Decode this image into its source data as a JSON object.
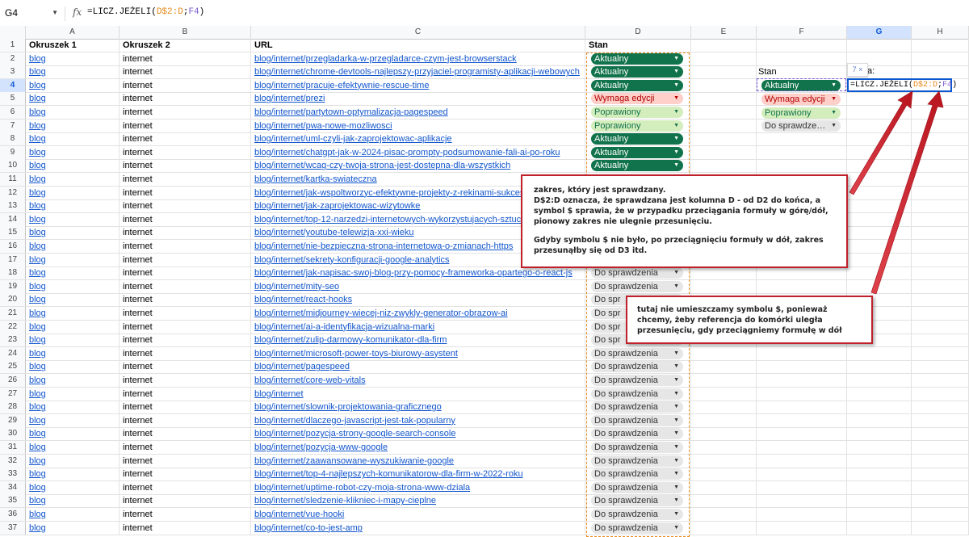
{
  "name_box": "G4",
  "formula": {
    "prefix": "=LICZ.JEŻELI(",
    "range_ref": "D$2:D",
    "sep": ";",
    "cell_ref": "F4",
    "suffix": ")"
  },
  "columns": [
    "A",
    "B",
    "C",
    "D",
    "E",
    "F",
    "G",
    "H"
  ],
  "selected_column": "G",
  "selected_row": "4",
  "headers": {
    "a": "Okruszek 1",
    "b": "Okruszek 2",
    "c": "URL",
    "d": "Stan"
  },
  "rows": [
    {
      "n": "2",
      "a": "blog",
      "b": "internet",
      "c": "blog/internet/przegladarka-w-przegladarce-czym-jest-browserstack",
      "d": "Aktualny"
    },
    {
      "n": "3",
      "a": "blog",
      "b": "internet",
      "c": "blog/internet/chrome-devtools-najlepszy-przyjaciel-programisty-aplikacji-webowych",
      "d": "Aktualny"
    },
    {
      "n": "4",
      "a": "blog",
      "b": "internet",
      "c": "blog/internet/pracuje-efektywnie-rescue-time",
      "d": "Aktualny"
    },
    {
      "n": "5",
      "a": "blog",
      "b": "internet",
      "c": "blog/internet/prezi",
      "d": "Wymaga edycji"
    },
    {
      "n": "6",
      "a": "blog",
      "b": "internet",
      "c": "blog/internet/partytown-optymalizacja-pagespeed",
      "d": "Poprawiony"
    },
    {
      "n": "7",
      "a": "blog",
      "b": "internet",
      "c": "blog/internet/pwa-nowe-mozliwosci",
      "d": "Poprawiony"
    },
    {
      "n": "8",
      "a": "blog",
      "b": "internet",
      "c": "blog/internet/uml-czyli-jak-zaprojektowac-aplikacje",
      "d": "Aktualny"
    },
    {
      "n": "9",
      "a": "blog",
      "b": "internet",
      "c": "blog/internet/chatgpt-jak-w-2024-pisac-prompty-podsumowanie-fali-ai-po-roku",
      "d": "Aktualny"
    },
    {
      "n": "10",
      "a": "blog",
      "b": "internet",
      "c": "blog/internet/wcag-czy-twoja-strona-jest-dostepna-dla-wszystkich",
      "d": "Aktualny"
    },
    {
      "n": "11",
      "a": "blog",
      "b": "internet",
      "c": "blog/internet/kartka-swiateczna",
      "d": ""
    },
    {
      "n": "12",
      "a": "blog",
      "b": "internet",
      "c": "blog/internet/jak-wspoltworzyc-efektywne-projekty-z-rekinami-sukcesu",
      "d": ""
    },
    {
      "n": "13",
      "a": "blog",
      "b": "internet",
      "c": "blog/internet/jak-zaprojektowac-wizytowke",
      "d": ""
    },
    {
      "n": "14",
      "a": "blog",
      "b": "internet",
      "c": "blog/internet/top-12-narzedzi-internetowych-wykorzystujacych-sztuczna",
      "d": ""
    },
    {
      "n": "15",
      "a": "blog",
      "b": "internet",
      "c": "blog/internet/youtube-telewizja-xxi-wieku",
      "d": ""
    },
    {
      "n": "16",
      "a": "blog",
      "b": "internet",
      "c": "blog/internet/nie-bezpieczna-strona-internetowa-o-zmianach-https",
      "d": ""
    },
    {
      "n": "17",
      "a": "blog",
      "b": "internet",
      "c": "blog/internet/sekrety-konfiguracji-google-analytics",
      "d": ""
    },
    {
      "n": "18",
      "a": "blog",
      "b": "internet",
      "c": "blog/internet/jak-napisac-swoj-blog-przy-pomocy-frameworka-opartego-o-react-js",
      "d": "Do sprawdzenia"
    },
    {
      "n": "19",
      "a": "blog",
      "b": "internet",
      "c": "blog/internet/mity-seo",
      "d": "Do sprawdzenia"
    },
    {
      "n": "20",
      "a": "blog",
      "b": "internet",
      "c": "blog/internet/react-hooks",
      "d": "Do spr"
    },
    {
      "n": "21",
      "a": "blog",
      "b": "internet",
      "c": "blog/internet/midjourney-wiecej-niz-zwykly-generator-obrazow-ai",
      "d": "Do spr"
    },
    {
      "n": "22",
      "a": "blog",
      "b": "internet",
      "c": "blog/internet/ai-a-identyfikacja-wizualna-marki",
      "d": "Do spr"
    },
    {
      "n": "23",
      "a": "blog",
      "b": "internet",
      "c": "blog/internet/zulip-darmowy-komunikator-dla-firm",
      "d": "Do spr"
    },
    {
      "n": "24",
      "a": "blog",
      "b": "internet",
      "c": "blog/internet/microsoft-power-toys-biurowy-asystent",
      "d": "Do sprawdzenia"
    },
    {
      "n": "25",
      "a": "blog",
      "b": "internet",
      "c": "blog/internet/pagespeed",
      "d": "Do sprawdzenia"
    },
    {
      "n": "26",
      "a": "blog",
      "b": "internet",
      "c": "blog/internet/core-web-vitals",
      "d": "Do sprawdzenia"
    },
    {
      "n": "27",
      "a": "blog",
      "b": "internet",
      "c": "blog/internet",
      "d": "Do sprawdzenia"
    },
    {
      "n": "28",
      "a": "blog",
      "b": "internet",
      "c": "blog/internet/slownik-projektowania-graficznego",
      "d": "Do sprawdzenia"
    },
    {
      "n": "29",
      "a": "blog",
      "b": "internet",
      "c": "blog/internet/dlaczego-javascript-jest-tak-popularny",
      "d": "Do sprawdzenia"
    },
    {
      "n": "30",
      "a": "blog",
      "b": "internet",
      "c": "blog/internet/pozycja-strony-google-search-console",
      "d": "Do sprawdzenia"
    },
    {
      "n": "31",
      "a": "blog",
      "b": "internet",
      "c": "blog/internet/pozycja-www-google",
      "d": "Do sprawdzenia"
    },
    {
      "n": "32",
      "a": "blog",
      "b": "internet",
      "c": "blog/internet/zaawansowane-wyszukiwanie-google",
      "d": "Do sprawdzenia"
    },
    {
      "n": "33",
      "a": "blog",
      "b": "internet",
      "c": "blog/internet/top-4-najlepszych-komunikatorow-dla-firm-w-2022-roku",
      "d": "Do sprawdzenia"
    },
    {
      "n": "34",
      "a": "blog",
      "b": "internet",
      "c": "blog/internet/uptime-robot-czy-moja-strona-www-dziala",
      "d": "Do sprawdzenia"
    },
    {
      "n": "35",
      "a": "blog",
      "b": "internet",
      "c": "blog/internet/sledzenie-klikniec-i-mapy-cieplne",
      "d": "Do sprawdzenia"
    },
    {
      "n": "36",
      "a": "blog",
      "b": "internet",
      "c": "blog/internet/vue-hooki",
      "d": "Do sprawdzenia"
    },
    {
      "n": "37",
      "a": "blog",
      "b": "internet",
      "c": "blog/internet/co-to-jest-amp",
      "d": "Do sprawdzenia"
    }
  ],
  "side_panel": {
    "stan_label": "Stan",
    "g3_label": "a:",
    "tooltip_count": "7 ×",
    "chips": [
      "Aktualny",
      "Wymaga edycji",
      "Poprawiony",
      "Do sprawdze…"
    ]
  },
  "notes": {
    "note1": [
      "zakres, który jest sprawdzany.",
      "D$2:D oznacza, że sprawdzana jest kolumna D - od D2 do końca, a symbol $ sprawia, że w przypadku przeciągania formuły w górę/dół, pionowy zakres nie ulegnie przesunięciu.",
      "Gdyby symbolu $ nie było, po przeciągnięciu formuły w dół, zakres przesunąłby się od D3 itd."
    ],
    "note2": "tutaj nie umieszczamy symbolu $, ponieważ chcemy, żeby referencja do komórki uległa przesunięciu, gdy przeciągniemy formułę w dół"
  },
  "colors": {
    "accent": "#0b57d0",
    "range_a": "#e8891a",
    "range_b": "#7b5ad3",
    "annotation": "#c0202a"
  }
}
